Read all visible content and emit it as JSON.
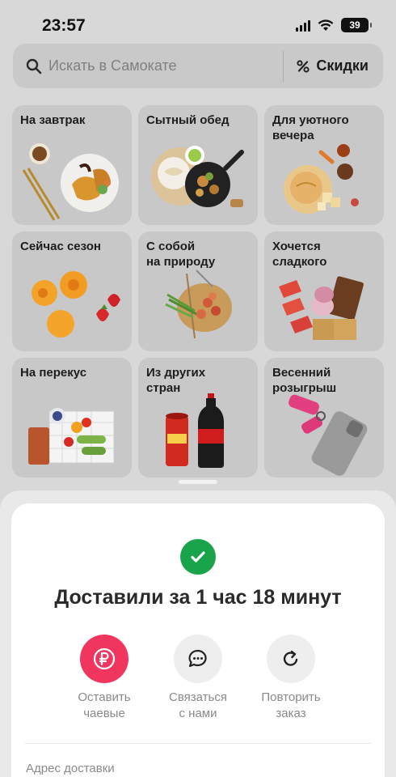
{
  "status_bar": {
    "time": "23:57",
    "battery": "39"
  },
  "search": {
    "placeholder": "Искать в Самокате",
    "discounts_label": "Скидки",
    "discounts_icon": "percent-icon"
  },
  "categories": [
    {
      "title": "На завтрак"
    },
    {
      "title": "Сытный обед"
    },
    {
      "title": "Для уютного\nвечера"
    },
    {
      "title": "Сейчас сезон"
    },
    {
      "title": "С собой\nна природу"
    },
    {
      "title": "Хочется\nсладкого"
    },
    {
      "title": "На перекус"
    },
    {
      "title": "Из других\nстран"
    },
    {
      "title": "Весенний\nрозыгрыш"
    }
  ],
  "order_sheet": {
    "title": "Доставили за 1 час 18 минут",
    "actions": [
      {
        "label": "Оставить\nчаевые",
        "icon": "ruble-icon",
        "color": "#f0355f"
      },
      {
        "label": "Связаться\nс нами",
        "icon": "chat-icon",
        "color": "#eeeeee"
      },
      {
        "label": "Повторить\nзаказ",
        "icon": "repeat-icon",
        "color": "#eeeeee"
      }
    ],
    "address_label": "Адрес доставки"
  },
  "colors": {
    "success": "#19a34a",
    "accent": "#f0355f"
  }
}
